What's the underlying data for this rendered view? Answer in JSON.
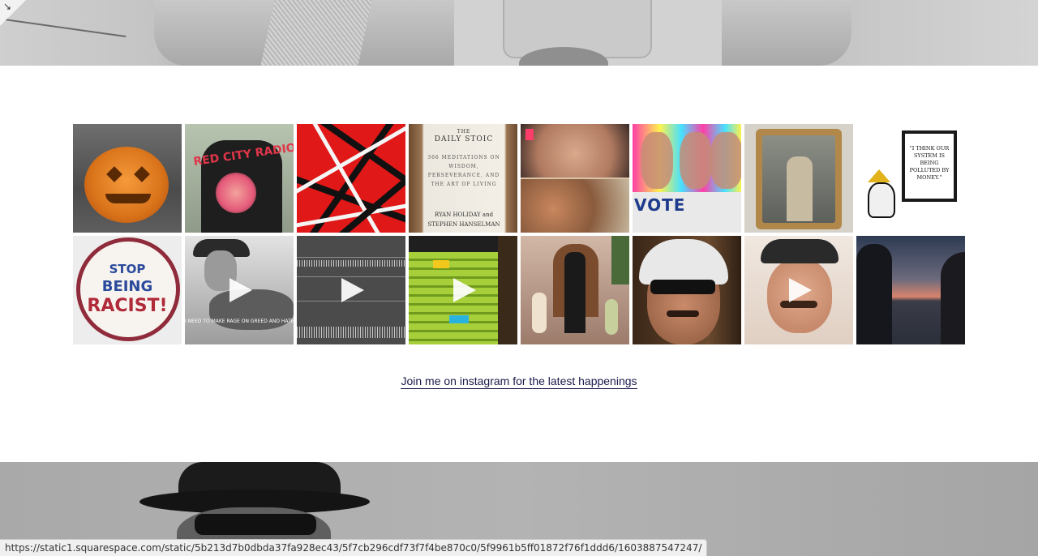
{
  "instagram": {
    "link_text": "Join me on instagram for the latest happenings",
    "tiles": [
      {
        "id": "pumpkin",
        "video": false
      },
      {
        "id": "red-city-radio-shirt",
        "shirt_text": "RED CITY RADIO",
        "video": false
      },
      {
        "id": "frankenstrat-stripes",
        "video": false
      },
      {
        "id": "daily-stoic-book",
        "book_brand": "THE",
        "book_title": "DAILY STOIC",
        "book_subtitle": "366 MEDITATIONS ON WISDOM, PERSEVERANCE, AND THE ART OF LIVING",
        "book_authors": "RYAN HOLIDAY and STEPHEN HANSELMAN",
        "video": false
      },
      {
        "id": "then-and-now-faces",
        "video": false
      },
      {
        "id": "vote-shirt-pop-art",
        "shirt_text": "VOTE",
        "video": false
      },
      {
        "id": "mirror-selfie",
        "video": false
      },
      {
        "id": "rbg-quote",
        "quote": "\"I THINK OUR SYSTEM IS BEING POLLUTED BY MONEY.\"",
        "video": false
      },
      {
        "id": "stop-being-racist",
        "line1": "STOP",
        "line2": "BEING",
        "line3": "RACIST!",
        "video": false
      },
      {
        "id": "guitar-video",
        "caption": "I NEED TO MAKE RAGE ON GREED AND HATEFUL THINGS",
        "video": true
      },
      {
        "id": "waveform-video",
        "video": true
      },
      {
        "id": "daw-video",
        "video": true
      },
      {
        "id": "dancing-kids",
        "video": false
      },
      {
        "id": "helmet-selfie",
        "video": false
      },
      {
        "id": "cap-selfie-video",
        "video": true
      },
      {
        "id": "sunset-silhouettes",
        "video": false
      }
    ]
  },
  "status_bar": {
    "url": "https://static1.squarespace.com/static/5b213d7b0dbda37fa928ec43/5f7cb296cdf73f7f4be870c0/5f9961b5ff01872f76f1ddd6/1603887547247/"
  },
  "icons": {
    "corner": "expand-arrow-icon",
    "play": "play-icon"
  }
}
